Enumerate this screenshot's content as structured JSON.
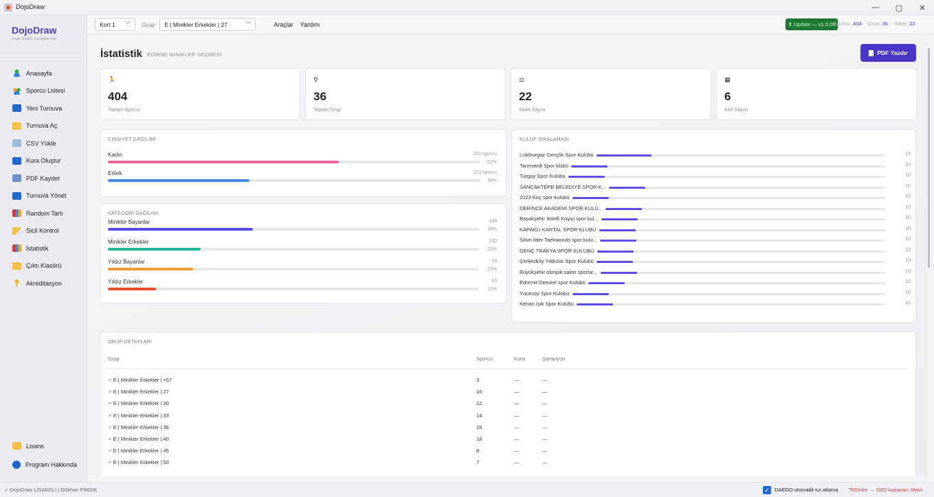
{
  "window": {
    "title": "DojoDraw",
    "controls": [
      "—",
      "▢",
      "✕"
    ]
  },
  "brand": {
    "name": "DojoDraw",
    "tagline": "Draw Smart. Compete Fair"
  },
  "sidebar": {
    "items": [
      {
        "label": "Anasayfa",
        "icon": "ic-user"
      },
      {
        "label": "Sporcu Listesi",
        "icon": "ic-users"
      },
      {
        "label": "Yeni Turnuva",
        "icon": "ic-vs"
      },
      {
        "label": "Turnuva Aç",
        "icon": "ic-folder"
      },
      {
        "label": "CSV Yükle",
        "icon": "ic-csv"
      },
      {
        "label": "Kura Oluştur",
        "icon": "ic-vs"
      },
      {
        "label": "PDF Kaydet",
        "icon": "ic-pdf"
      },
      {
        "label": "Turnuva Yönet",
        "icon": "ic-vs"
      },
      {
        "label": "Random Tartı",
        "icon": "ic-chart"
      },
      {
        "label": "Sicil Kontrol",
        "icon": "ic-folder2"
      },
      {
        "label": "İstatistik",
        "icon": "ic-chart"
      },
      {
        "label": "Çıktı Klasörü",
        "icon": "ic-folder"
      },
      {
        "label": "Akreditasyon",
        "icon": "ic-key"
      }
    ],
    "bottom": [
      {
        "label": "Lisans",
        "icon": "ic-lock"
      },
      {
        "label": "Program Hakkında",
        "icon": "ic-info"
      }
    ]
  },
  "topbar": {
    "court": "Kort 1",
    "group_label": "Grup:",
    "group": "E | Minikler Erkekler | 27",
    "menu_tools": "Araçlar",
    "menu_help": "Yardım",
    "update": "⬆ Update — v1.0.05",
    "athletes_label": "Sporcu:",
    "athletes": "404",
    "groups_label": "Grup:",
    "groups": "36",
    "weights_label": "Siklet:",
    "weights": "22"
  },
  "page": {
    "title": "İstatistik",
    "subtitle": "EDİRNE MİNİKLER SEÇMESİ",
    "pdf_button": "PDF Yazdır"
  },
  "stats": [
    {
      "icon": "🏃",
      "value": "404",
      "label": "Toplam Sporcu"
    },
    {
      "icon": "⚲",
      "value": "36",
      "label": "Toplam Grup"
    },
    {
      "icon": "⚖",
      "value": "22",
      "label": "Siklet Sayısı"
    },
    {
      "icon": "▦",
      "value": "6",
      "label": "Kort Sayısı"
    }
  ],
  "gender": {
    "title": "CİNSİYET DAĞILIMI",
    "rows": [
      {
        "label": "Kadın",
        "count": "251 sporcu",
        "pct": "62%",
        "fraction": 0.62,
        "color": "#e8679a"
      },
      {
        "label": "Erkek",
        "count": "153 sporcu",
        "pct": "38%",
        "fraction": 0.38,
        "color": "#3f8fe0"
      }
    ]
  },
  "categories": {
    "title": "KATEGORİ DAĞILIMI",
    "rows": [
      {
        "label": "Minikler Bayanlar",
        "count": "158",
        "pct": "39%",
        "fraction": 0.39,
        "color": "#5b4ae0"
      },
      {
        "label": "Minikler Erkekler",
        "count": "100",
        "pct": "25%",
        "fraction": 0.25,
        "color": "#1fb59a"
      },
      {
        "label": "Yıldız Bayanlar",
        "count": "93",
        "pct": "23%",
        "fraction": 0.23,
        "color": "#f09a36"
      },
      {
        "label": "Yıldız Erkekler",
        "count": "53",
        "pct": "13%",
        "fraction": 0.13,
        "color": "#e24f2b"
      }
    ]
  },
  "clubs": {
    "title": "KULÜP SIRALAMASI",
    "max": 15,
    "rows": [
      {
        "name": "Lüleburgaz Gençlik Spor Kulübü",
        "value": 15
      },
      {
        "name": "Tanrıverdi Spor klübü",
        "value": 10
      },
      {
        "name": "Turgay Spor Kulübü",
        "value": 10
      },
      {
        "name": "SANCAKTEPE BELEDİYE SPOR K...",
        "value": 10
      },
      {
        "name": "2023 Koç spor kulübü",
        "value": 10
      },
      {
        "name": "DERİNCE AKADEMİ SPOR KULÜ...",
        "value": 10
      },
      {
        "name": "Başakşehir İkitelli Köyiçi spor kul...",
        "value": 10
      },
      {
        "name": "KAPAKLI KARTAL SPOR KLUBÜ",
        "value": 10
      },
      {
        "name": "Silivri lider Taekwondo spor kulü...",
        "value": 10
      },
      {
        "name": "GENÇ TRAKYA SPOR KULÜBÜ",
        "value": 10
      },
      {
        "name": "Çerkezköy Yıldızlar Spor Kulübü",
        "value": 10
      },
      {
        "name": "Büyükşehir olimpik salon sporlar...",
        "value": 10
      },
      {
        "name": "Edremit Demirel spor Kulübü",
        "value": 10
      },
      {
        "name": "Yücesoy Spor Kulübü",
        "value": 10
      },
      {
        "name": "Kenan Işık Spor Kulübü",
        "value": 10
      }
    ]
  },
  "groups_table": {
    "title": "GRUP DETAYLARI",
    "headers": {
      "group": "Grup",
      "athletes": "Sporcu",
      "draw": "Kura",
      "champion": "Şampiyon"
    },
    "rows": [
      {
        "group": "♂ E | Minikler Erkekler | +57",
        "athletes": "3",
        "draw": "—",
        "champion": "—"
      },
      {
        "group": "♂ E | Minikler Erkekler | 27",
        "athletes": "16",
        "draw": "—",
        "champion": "—"
      },
      {
        "group": "♂ E | Minikler Erkekler | 30",
        "athletes": "12",
        "draw": "—",
        "champion": "—"
      },
      {
        "group": "♂ E | Minikler Erkekler | 33",
        "athletes": "14",
        "draw": "—",
        "champion": "—"
      },
      {
        "group": "♂ E | Minikler Erkekler | 36",
        "athletes": "19",
        "draw": "—",
        "champion": "—"
      },
      {
        "group": "♂ E | Minikler Erkekler | 40",
        "athletes": "18",
        "draw": "—",
        "champion": "—"
      },
      {
        "group": "♂ E | Minikler Erkekler | 45",
        "athletes": "8",
        "draw": "—",
        "champion": "—"
      },
      {
        "group": "♂ E | Minikler Erkekler | 50",
        "athletes": "7",
        "draw": "—",
        "champion": "—"
      }
    ]
  },
  "statusbar": {
    "license": "✓ DojoDraw LİSANSLI | Gökhan FINDIK",
    "daedo": "DAEDO otomatik tur atlama",
    "tkstrike": "TkStrike → 1002 kazanan: Mavi"
  }
}
